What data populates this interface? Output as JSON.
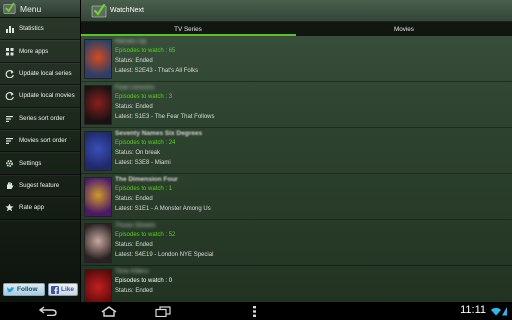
{
  "drawer": {
    "title": "Menu",
    "items": [
      {
        "label": "Statistics",
        "icon": "bar-chart-icon"
      },
      {
        "label": "More apps",
        "icon": "grid-icon"
      },
      {
        "label": "Update local series",
        "icon": "refresh-icon"
      },
      {
        "label": "Update local movies",
        "icon": "refresh-icon"
      },
      {
        "label": "Series sort order",
        "icon": "sort-icon"
      },
      {
        "label": "Movies sort order",
        "icon": "sort-icon"
      },
      {
        "label": "Settings",
        "icon": "gear-icon"
      },
      {
        "label": "Sugest feature",
        "icon": "hand-icon"
      },
      {
        "label": "Rate app",
        "icon": "star-icon"
      }
    ],
    "follow_label": "Follow",
    "like_label": "Like"
  },
  "app": {
    "title": "WatchNext"
  },
  "tabs": [
    {
      "label": "TV Series",
      "active": true
    },
    {
      "label": "Movies",
      "active": false
    }
  ],
  "series": [
    {
      "title": "Heroes Up",
      "episodes": "Episodes to watch : 65",
      "status": "Status: Ended",
      "latest": "Latest: S2E43 - That's All Folks",
      "colors": [
        "#2a3f6a",
        "#d24a1e"
      ]
    },
    {
      "title": "Fear Lessons",
      "episodes": "Episodes to watch : 3",
      "status": "Status: Ended",
      "latest": "Latest: S1E3 - The Fear That Follows",
      "colors": [
        "#1a1212",
        "#8a1f1f"
      ]
    },
    {
      "title": "Seventy Names Six Degrees",
      "episodes": "Episodes to watch : 24",
      "status": "Status: On break",
      "latest": "Latest: S3E8 - Miami",
      "colors": [
        "#1f2a6a",
        "#3a4fb8"
      ]
    },
    {
      "title": "The Dimension Four",
      "episodes": "Episodes to watch : 1",
      "status": "Status: Ended",
      "latest": "Latest: S1E1 - A Monster Among Us",
      "colors": [
        "#4a1a6a",
        "#d09a2a"
      ]
    },
    {
      "title": "Those Streets",
      "episodes": "Episodes to watch : 52",
      "status": "Status: Ended",
      "latest": "Latest: S4E19 - London NYE Special",
      "colors": [
        "#2a2222",
        "#c8a8a0"
      ]
    },
    {
      "title": "Time Killers",
      "episodes": "Episodes to watch : 0",
      "status": "Status: Ended",
      "latest": "",
      "colors": [
        "#5a0a0a",
        "#c42020"
      ]
    }
  ],
  "system": {
    "time": "11:11"
  }
}
